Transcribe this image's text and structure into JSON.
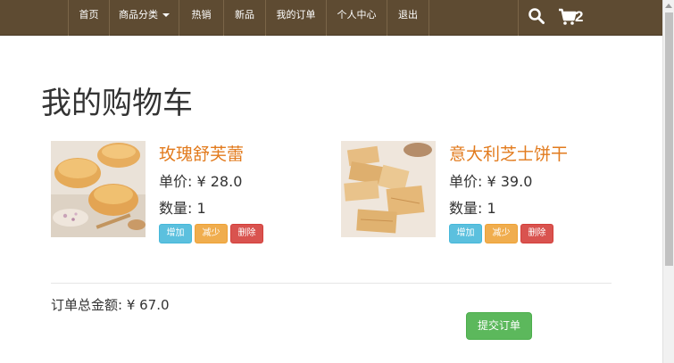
{
  "nav": {
    "items": [
      {
        "label": "首页"
      },
      {
        "label": "商品分类"
      },
      {
        "label": "热销"
      },
      {
        "label": "新品"
      },
      {
        "label": "我的订单"
      },
      {
        "label": "个人中心"
      },
      {
        "label": "退出"
      }
    ],
    "cart_count": "2"
  },
  "page": {
    "title": "我的购物车"
  },
  "cart": {
    "items": [
      {
        "name": "玫瑰舒芙蕾",
        "price_text": "单价: ¥ 28.0",
        "qty_text": "数量: 1",
        "btn_add": "增加",
        "btn_reduce": "减少",
        "btn_delete": "删除"
      },
      {
        "name": "意大利芝士饼干",
        "price_text": "单价: ¥ 39.0",
        "qty_text": "数量: 1",
        "btn_add": "增加",
        "btn_reduce": "减少",
        "btn_delete": "删除"
      }
    ],
    "total_text": "订单总金额: ¥ 67.0",
    "submit_label": "提交订单"
  },
  "colors": {
    "navbar": "#5e4b32",
    "product_name": "#e27b1e",
    "btn_add": "#5bc0de",
    "btn_reduce": "#f0ad4e",
    "btn_delete": "#d9534f",
    "btn_submit": "#5cb85c"
  }
}
